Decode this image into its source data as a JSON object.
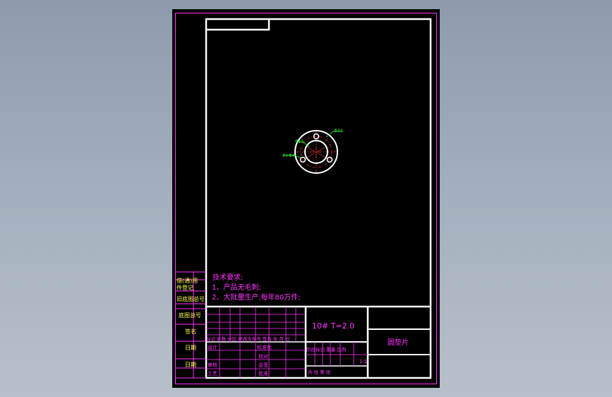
{
  "colors": {
    "background": "#9aa6b5",
    "sheet": "#000000",
    "frame": "#ffffff",
    "magenta": "#ff33ff",
    "green": "#33ff33",
    "yellow": "#ffff44",
    "red": "#ff3333"
  },
  "drawing": {
    "dim_outer": "Φ34",
    "dim_inner": "Φ15",
    "dim_holes": "3×Φ4"
  },
  "tech_req": {
    "title": "技术要求:",
    "line1": "1、产品无毛刺;",
    "line2": "2、大批量生产,每年80万件;"
  },
  "side_labels": {
    "l1": "借(通)用",
    "l2": "件登记",
    "l3": "旧底图总号",
    "l4": "底图总号",
    "l5": "签名",
    "l6": "日期",
    "l7": "日期"
  },
  "title_block": {
    "material": "10#  T=2.0",
    "part_name": "圆垫片",
    "rev_header": "标记 处数 分区 更改文件号 签名 年 月 日",
    "design": "设计",
    "std": "标准化",
    "check": "审核",
    "craft": "工艺",
    "proofread": "校对",
    "approve": "批准",
    "jointsign": "会签",
    "stage_header": "阶段标记  重量 比例",
    "scale": "1:1",
    "sheets": "共   张   第   张"
  }
}
